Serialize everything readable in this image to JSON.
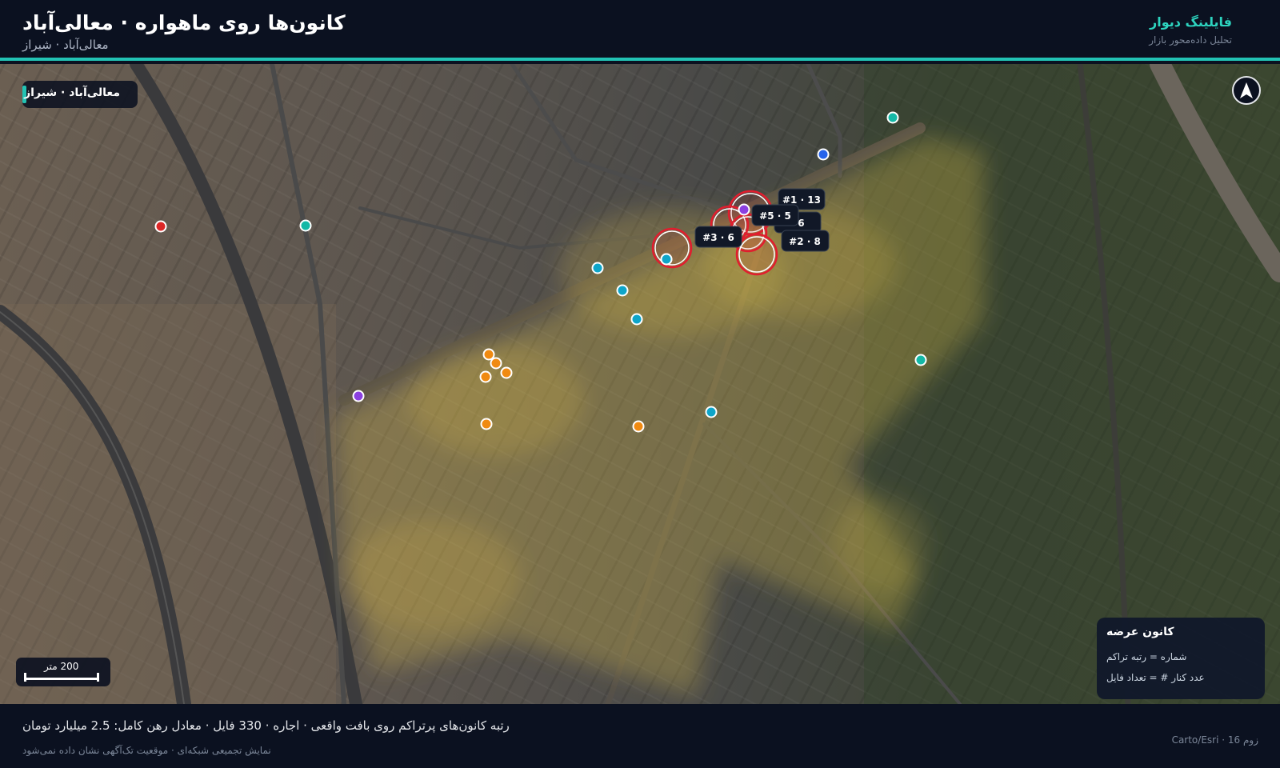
{
  "header": {
    "title": "کانون‌ها روی ماهواره · معالی‌آباد",
    "subtitle": "معالی‌آباد · شیراز",
    "brand": "فایلینگ دیوار",
    "brand_sub": "تحلیل داده‌محور بازار"
  },
  "map": {
    "place_label": "معالی‌آباد · شیراز",
    "compass": "north-arrow-icon",
    "scale_label": "200 متر",
    "hotspots": [
      {
        "rank": "#1",
        "count": "13",
        "label": "#1 · 13"
      },
      {
        "rank": "#5",
        "count": "5",
        "label": "#5 · 5"
      },
      {
        "rank": "#4",
        "count": "6",
        "label": "· 6"
      },
      {
        "rank": "#3",
        "count": "6",
        "label": "#3 · 6"
      },
      {
        "rank": "#2",
        "count": "8",
        "label": "#2 · 8"
      }
    ],
    "colors": {
      "hotspot_ring": "#e11d2e",
      "teal": "#14b8a6",
      "cyan": "#0ea5c9",
      "orange": "#f08a11",
      "purple": "#8b3fe0",
      "blue": "#2563eb",
      "red": "#dc2626",
      "density": "#e8c84a"
    }
  },
  "legend": {
    "title": "کانون عرضه",
    "line1": "شماره = رتبه تراکم",
    "line2": "عدد کنار # = تعداد فایل"
  },
  "footer": {
    "summary": "رتبه کانون‌های پرتراکم روی بافت واقعی · اجاره · 330 فایل · معادل رهن کامل: 2.5 میلیارد تومان",
    "note": "نمایش تجمیعی شبکه‌ای · موقعیت تک‌آگهی نشان داده نمی‌شود",
    "meta": "زوم 16 · Carto/Esri"
  }
}
